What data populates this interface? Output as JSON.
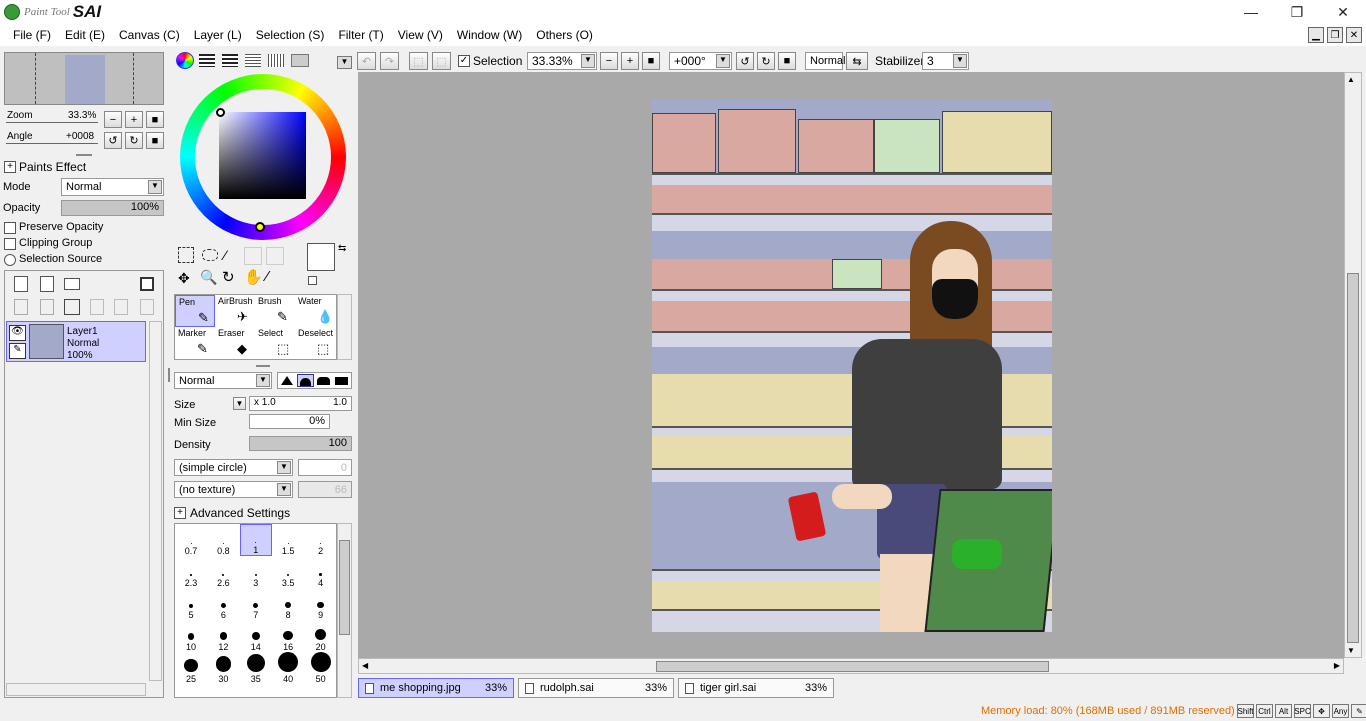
{
  "app": {
    "logo_line1": "Paint Tool",
    "logo_line2": "SAI"
  },
  "window_controls": {
    "minimize": "—",
    "maximize": "❐",
    "close": "✕"
  },
  "menu": [
    "File (F)",
    "Edit (E)",
    "Canvas (C)",
    "Layer (L)",
    "Selection (S)",
    "Filter (T)",
    "View (V)",
    "Window (W)",
    "Others (O)"
  ],
  "navigator": {
    "zoom_label": "Zoom",
    "zoom_value": "33.3%",
    "angle_label": "Angle",
    "angle_value": "+0008"
  },
  "paints_effect": {
    "header": "Paints Effect",
    "mode_label": "Mode",
    "mode_value": "Normal",
    "opacity_label": "Opacity",
    "opacity_value": "100%",
    "preserve_opacity": "Preserve Opacity",
    "clipping_group": "Clipping Group",
    "selection_source": "Selection Source"
  },
  "layers": [
    {
      "name": "Layer1",
      "mode": "Normal",
      "opacity": "100%"
    }
  ],
  "tools": [
    {
      "name": "Pen",
      "id": "pen"
    },
    {
      "name": "AirBrush",
      "id": "airbrush"
    },
    {
      "name": "Brush",
      "id": "brush"
    },
    {
      "name": "Water",
      "id": "water"
    },
    {
      "name": "Marker",
      "id": "marker"
    },
    {
      "name": "Eraser",
      "id": "eraser"
    },
    {
      "name": "Select",
      "id": "select"
    },
    {
      "name": "Deselect",
      "id": "deselect"
    }
  ],
  "brush": {
    "blend_mode": "Normal",
    "size_label": "Size",
    "size_mult": "x 1.0",
    "size_value": "1.0",
    "min_size_label": "Min Size",
    "min_size_value": "0%",
    "density_label": "Density",
    "density_value": "100",
    "shape": "(simple circle)",
    "shape_value": "0",
    "texture": "(no texture)",
    "texture_value": "66",
    "advanced": "Advanced Settings",
    "sizes": [
      "0.7",
      "0.8",
      "1",
      "1.5",
      "2",
      "2.3",
      "2.6",
      "3",
      "3.5",
      "4",
      "5",
      "6",
      "7",
      "8",
      "9",
      "10",
      "12",
      "14",
      "16",
      "20",
      "25",
      "30",
      "35",
      "40",
      "50"
    ]
  },
  "toolbar": {
    "selection_label": "Selection",
    "zoom_value": "33.33%",
    "rotation_value": "+000°",
    "blend_value": "Normal",
    "stabilizer_label": "Stabilizer",
    "stabilizer_value": "3"
  },
  "tabs": [
    {
      "name": "me shopping.jpg",
      "zoom": "33%",
      "active": true
    },
    {
      "name": "rudolph.sai",
      "zoom": "33%",
      "active": false
    },
    {
      "name": "tiger girl.sai",
      "zoom": "33%",
      "active": false
    }
  ],
  "status": {
    "memory": "Memory load: 80% (168MB used / 891MB reserved)",
    "memory_color": "#e07000",
    "keys": [
      "Shift",
      "Ctrl",
      "Alt",
      "SPC",
      "✥",
      "Any",
      "✎"
    ]
  },
  "colors": {
    "primary": "#0000aa",
    "canvas_bg": "#a9a9a9",
    "selected": "#cfd0ff"
  }
}
